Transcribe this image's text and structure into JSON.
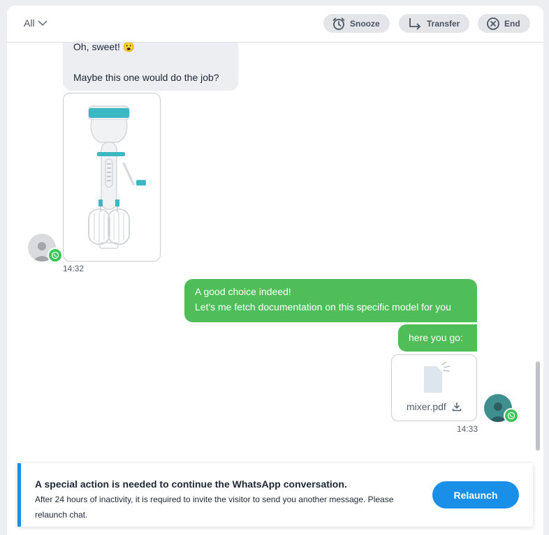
{
  "header": {
    "filter_label": "All",
    "snooze_label": "Snooze",
    "transfer_label": "Transfer",
    "end_label": "End"
  },
  "conversation": {
    "incoming": {
      "line1": "Oh, sweet! 😮",
      "line2": "Maybe this one would do the job?",
      "time": "14:32"
    },
    "outgoing": {
      "message1_line1": "A good choice indeed!",
      "message1_line2": "Let's me fetch documentation on this specific model for you",
      "message2": "here you go:",
      "file_name": "mixer.pdf",
      "time": "14:33"
    }
  },
  "notice": {
    "title": "A special action is needed to continue the WhatsApp conversation.",
    "body": "After 24 hours of inactivity, it is required to invite the visitor to send you another message. Please relaunch chat.",
    "button_label": "Relaunch"
  },
  "colors": {
    "accent_blue": "#1a8fe8",
    "outgoing_green": "#4fbe58",
    "whatsapp_green": "#3ec45a"
  }
}
